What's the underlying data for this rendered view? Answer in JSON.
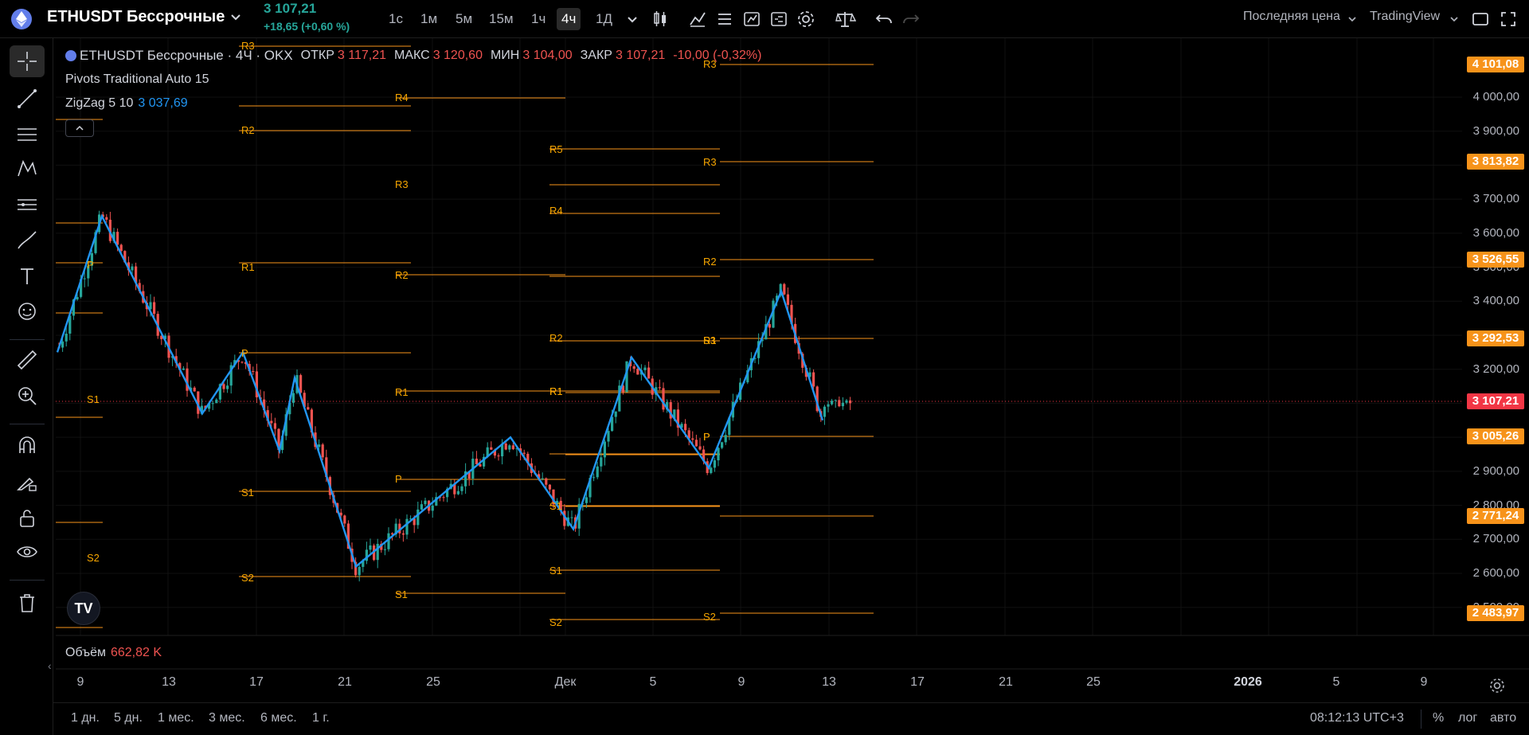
{
  "header": {
    "symbol": "ETHUSDT Бессрочные",
    "last_price": "3 107,21",
    "change": "+18,65 (+0,60 %)",
    "timeframes": [
      "1с",
      "1м",
      "5м",
      "15м",
      "1ч",
      "4ч",
      "1Д"
    ],
    "active_timeframe": "4ч",
    "price_type": "Последняя цена",
    "chart_type": "TradingView"
  },
  "legend": {
    "title": "ETHUSDT Бессрочные · 4Ч · OKX",
    "open_label": "ОТКР",
    "open": "3 117,21",
    "high_label": "МАКС",
    "high": "3 120,60",
    "low_label": "МИН",
    "low": "3 104,00",
    "close_label": "ЗАКР",
    "close": "3 107,21",
    "change": "-10,00 (-0,32%)"
  },
  "indicators": {
    "pivots": "Pivots Traditional Auto 15",
    "zigzag": "ZigZag 5 10",
    "zigzag_value": "3 037,69"
  },
  "price_axis": {
    "labels": [
      "4 000,00",
      "3 900,00",
      "3 700,00",
      "3 600,00",
      "3 500,00",
      "3 400,00",
      "3 200,00",
      "2 900,00",
      "2 800,00",
      "2 700,00",
      "2 600,00",
      "2 500,00"
    ],
    "tags": [
      {
        "text": "4 101,08",
        "color": "#f7931a"
      },
      {
        "text": "3 813,82",
        "color": "#f7931a"
      },
      {
        "text": "3 526,55",
        "color": "#f7931a"
      },
      {
        "text": "3 292,53",
        "color": "#f7931a"
      },
      {
        "text": "3 107,21",
        "color": "#f23645"
      },
      {
        "text": "3 005,26",
        "color": "#f7931a"
      },
      {
        "text": "2 771,24",
        "color": "#f7931a"
      },
      {
        "text": "2 483,97",
        "color": "#f7931a"
      }
    ]
  },
  "pivot_labels": [
    "R3",
    "R4",
    "R2",
    "R5",
    "R3",
    "R4",
    "R3",
    "R1",
    "R2",
    "R2",
    "R3",
    "R2",
    "P",
    "R1",
    "P",
    "R1",
    "S1",
    "P",
    "P",
    "S1",
    "S1",
    "S1",
    "S2",
    "S2",
    "S1",
    "S2",
    "S2",
    "S3",
    "R1",
    "R1",
    "P"
  ],
  "volume": {
    "label": "Объём",
    "value": "662,82 K"
  },
  "time_axis": [
    "9",
    "13",
    "17",
    "21",
    "25",
    "Дек",
    "5",
    "9",
    "13",
    "17",
    "21",
    "25",
    "2026",
    "5",
    "9"
  ],
  "bottom": {
    "ranges": [
      "1 дн.",
      "5 дн.",
      "1 мес.",
      "3 мес.",
      "6 мес.",
      "1 г."
    ],
    "clock": "08:12:13 UTC+3",
    "percent": "%",
    "log": "лог",
    "auto": "авто"
  },
  "logo_text": "TV",
  "colors": {
    "up": "#26a69a",
    "down": "#ef5350",
    "pivot": "#f7931a",
    "zigzag": "#2196f3",
    "background": "#000000"
  }
}
